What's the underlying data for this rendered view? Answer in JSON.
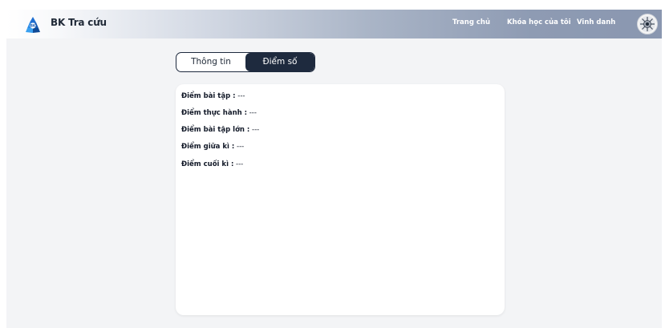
{
  "navbar": {
    "brand": "BK Tra cứu",
    "links": [
      "Trang chủ",
      "Khóa học của tôi",
      "Vinh danh"
    ],
    "logo_icon": "bk-logo-icon",
    "avatar_icon": "user-avatar-icon",
    "gradient_start": "#ffffff",
    "gradient_end": "#8a97b0"
  },
  "tabs": {
    "info_label": "Thông tin",
    "score_label": "Điểm số",
    "active": "Điểm số",
    "active_bg": "#1e2a3e"
  },
  "scores": [
    {
      "label": "Điểm bài tập :",
      "value": "---"
    },
    {
      "label": "Điểm thực hành :",
      "value": "---"
    },
    {
      "label": "Điểm bài tập lớn :",
      "value": "---"
    },
    {
      "label": "Điểm giữa kì :",
      "value": "---"
    },
    {
      "label": "Điểm cuối kì :",
      "value": "---"
    }
  ]
}
